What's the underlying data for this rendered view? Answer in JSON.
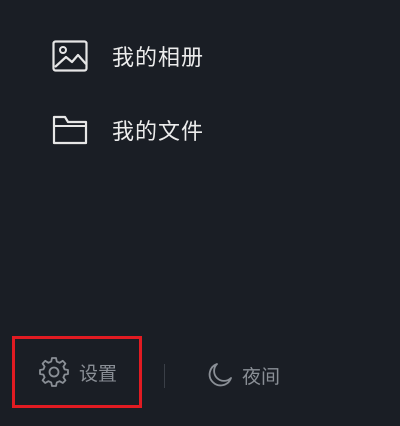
{
  "menu": {
    "items": [
      {
        "label": "我的相册",
        "icon": "image-icon"
      },
      {
        "label": "我的文件",
        "icon": "folder-icon"
      }
    ]
  },
  "bottom": {
    "settings_label": "设置",
    "night_label": "夜间"
  },
  "colors": {
    "background": "#1a1e25",
    "text": "#ececec",
    "muted_text": "#8a8f96",
    "highlight_border": "#e11b22"
  }
}
